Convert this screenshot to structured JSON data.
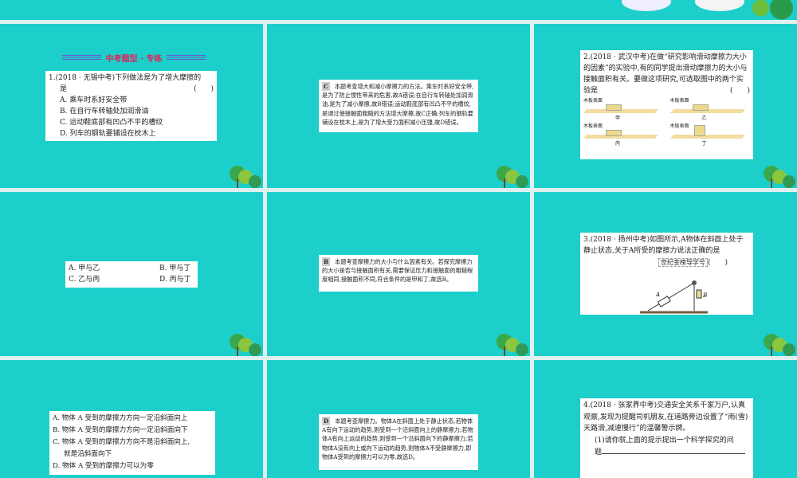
{
  "slide1": {
    "header": "中考题型 · 专练",
    "lines": [
      "1.(2018 · 无锡中考)下列做法是为了增大摩擦的",
      "是",
      "(　　)",
      "A. 乘车时系好安全带",
      "B. 在自行车转轴处加润滑油",
      "C. 运动鞋底部有凹凸不平的槽纹",
      "D. 列车的钢轨要铺设在枕木上"
    ]
  },
  "slide2": {
    "answer": "C",
    "text": "本题考查增大和减小摩擦力的方法。乘车时系好安全带,是为了防止惯性带来的危害,故A错误;在自行车转轴处加润滑油,是为了减小摩擦,故B错误;运动鞋底部有凹凸不平的槽纹,是通过使接触面粗糙的方法增大摩擦,故C正确;列车的钢轨要铺设在枕木上,是为了增大受力面积减小压强,故D错误。"
  },
  "slide3": {
    "text": "2.(2018 · 武汉中考)在做“研究影响滑动摩擦力大小的因素”的实验中,有的同学提出滑动摩擦力的大小与接触面积有关。要做这项研究,可选取图中的两个实验是",
    "paren": "(　　)",
    "surface": "木板表面",
    "labels": [
      "甲",
      "乙",
      "丙",
      "丁"
    ]
  },
  "slide4": {
    "options": [
      "A. 甲与乙",
      "B. 甲与丁",
      "C. 乙与丙",
      "D. 丙与丁"
    ]
  },
  "slide5": {
    "answer": "B",
    "text": "本题考查摩擦力的大小与什么因素有关。若探究摩擦力的大小是否与接触面积有关,需要保证压力和接触面的粗糙程度相同,接触面积不同,符合条件的是甲和丁,故选B。"
  },
  "slide6": {
    "text": "3.(2018 · 扬州中考)如图所示,A物体在斜面上处于静止状态,关于A所受的摩擦力说法正确的是",
    "watermark": "世纪金榜导学号",
    "paren": "(　　)",
    "labelA": "A",
    "labelB": "B"
  },
  "slide7": {
    "options": [
      "A. 物体 A 受到的摩擦力方向一定沿斜面向上",
      "B. 物体 A 受到的摩擦力方向一定沿斜面向下",
      "C. 物体 A 受到的摩擦力方向不是沿斜面向上,",
      "就是沿斜面向下",
      "D. 物体 A 受到的摩擦力可以为零"
    ]
  },
  "slide8": {
    "answer": "D",
    "text": "本题考查摩擦力。物体A在斜面上处于静止状态,若物体A有向下运动的趋势,则受到一个沿斜面向上的静摩擦力;若物体A有向上运动的趋势,则受到一个沿斜面向下的静摩擦力;若物体A没有向上或向下运动的趋势,则物体A不受静摩擦力,即物体A受到的摩擦力可以为零,故选D。"
  },
  "slide9": {
    "text": "4.(2018 · 张家界中考)交通安全关系千家万户,认真观察,发现为提醒司机朋友,在道路旁边设置了“雨(雪)天路滑,减速慢行”的温馨警示牌。",
    "q1": "(1)请你就上面的提示提出一个科学探究的问",
    "q1b": "题"
  }
}
